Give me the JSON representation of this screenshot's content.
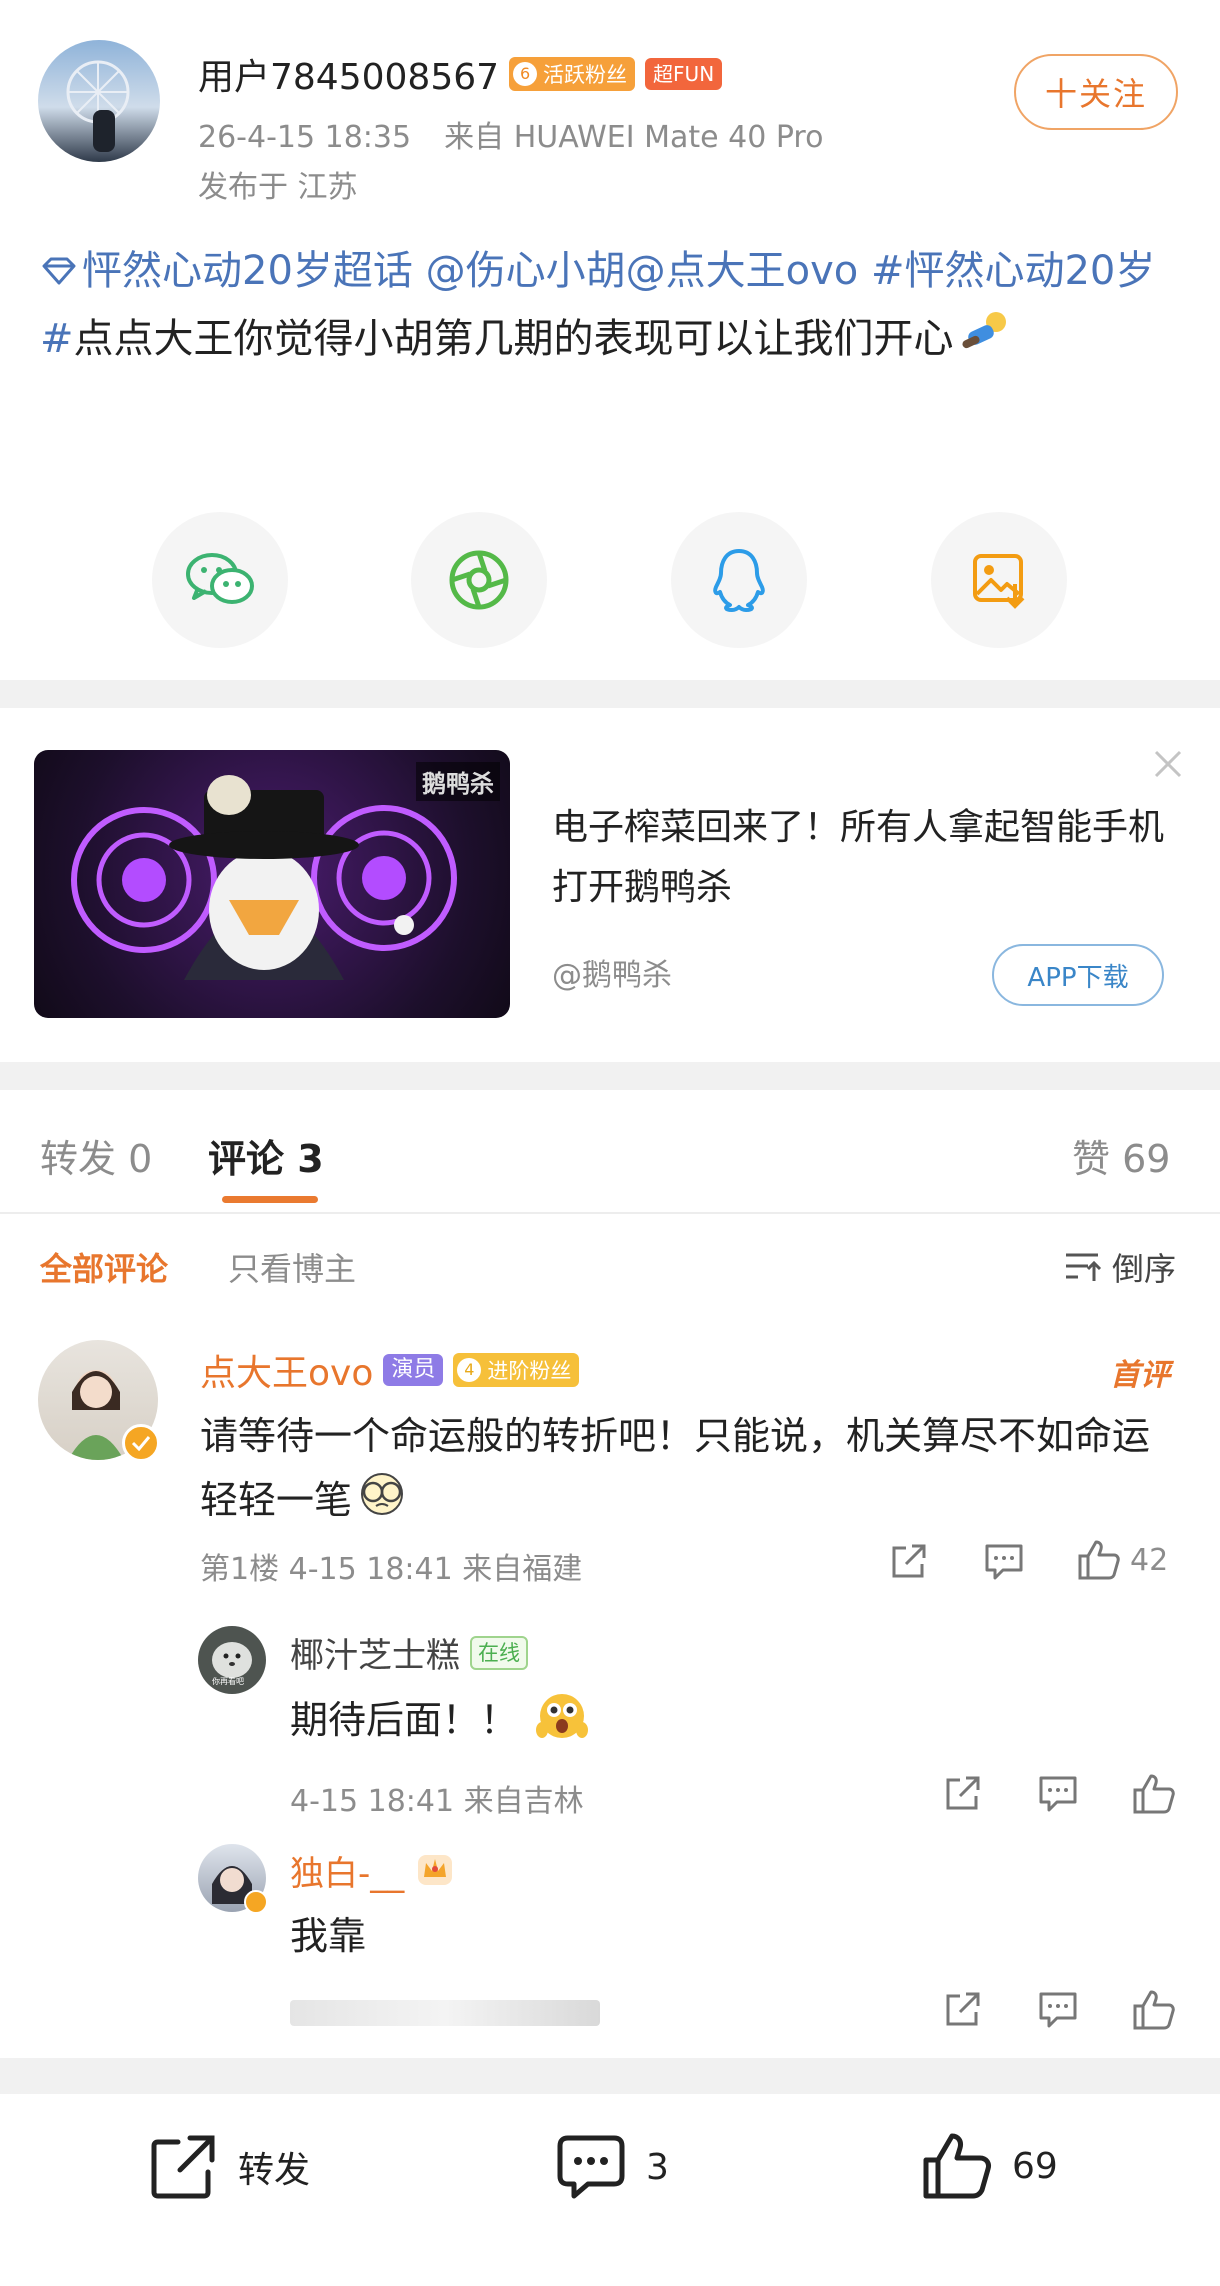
{
  "post": {
    "username": "用户7845008567",
    "fan_badge_level": "6",
    "fan_badge_text": "活跃粉丝",
    "fun_badge": "超FUN",
    "time": "26-4-15 18:35",
    "source": "来自 HUAWEI Mate 40 Pro",
    "location": "发布于 江苏",
    "follow_label": "十关注",
    "text_topic": "怦然心动20岁超话",
    "text_mention1": "@伤心小胡",
    "text_mention2": "@点大王ovo",
    "text_hashtag": "#怦然心动20岁#",
    "text_body": "点点大王你觉得小胡第几期的表现可以让我们开心",
    "share_icons": [
      "wechat-icon",
      "moments-icon",
      "qq-icon",
      "save-image-icon"
    ]
  },
  "ad": {
    "game_logo_text": "鹅鸭杀",
    "title": "电子榨菜回来了！所有人拿起智能手机打开鹅鸭杀",
    "account": "@鹅鸭杀",
    "download_label": "APP下载"
  },
  "tabs": {
    "repost_label": "转发",
    "repost_count": "0",
    "comment_label": "评论",
    "comment_count": "3",
    "like_label": "赞",
    "like_count": "69"
  },
  "filters": {
    "all": "全部评论",
    "author_only": "只看博主",
    "sort": "倒序"
  },
  "comments": [
    {
      "name": "点大王ovo",
      "role_badge": "演员",
      "fan_level": "4",
      "fan_text": "进阶粉丝",
      "first_tag": "首评",
      "text": "请等待一个命运般的转折吧！只能说，机关算尽不如命运轻轻一笔",
      "meta": "第1楼 4-15 18:41 来自福建",
      "likes": "42"
    }
  ],
  "replies": [
    {
      "name": "椰汁芝士糕",
      "status_badge": "在线",
      "avatar_text": "你再看吧",
      "text": "期待后面！！",
      "meta": "4-15 18:41 来自吉林"
    },
    {
      "name": "独白-__",
      "text": "我靠"
    }
  ],
  "bottom_bar": {
    "repost_label": "转发",
    "comment_count": "3",
    "like_count": "69"
  },
  "colors": {
    "accent_orange": "#e8762d",
    "link_blue": "#4a74b8",
    "divider": "#f1f1f1"
  }
}
